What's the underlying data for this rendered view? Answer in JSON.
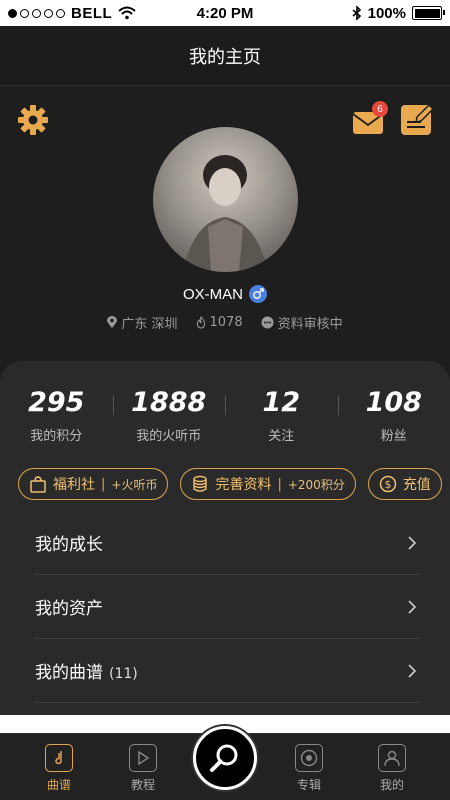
{
  "status_bar": {
    "carrier": "BELL",
    "time": "4:20 PM",
    "battery": "100%"
  },
  "nav": {
    "title": "我的主页"
  },
  "header": {
    "mail_badge": "6",
    "username": "OX-MAN",
    "location": "广东 深圳",
    "heat": "1078",
    "status": "资料审核中"
  },
  "stats": [
    {
      "value": "295",
      "label": "我的积分"
    },
    {
      "value": "1888",
      "label": "我的火听币"
    },
    {
      "value": "12",
      "label": "关注"
    },
    {
      "value": "108",
      "label": "粉丝"
    }
  ],
  "pills": [
    {
      "label": "福利社",
      "sub": "+火听币",
      "icon": "bag-icon"
    },
    {
      "label": "完善资料",
      "sub": "+200积分",
      "icon": "coins-stack-icon"
    },
    {
      "label": "充值",
      "sub": "",
      "icon": "dollar-icon"
    }
  ],
  "menu": [
    {
      "label": "我的成长",
      "count": ""
    },
    {
      "label": "我的资产",
      "count": ""
    },
    {
      "label": "我的曲谱",
      "count": "(11)"
    }
  ],
  "tabs": [
    {
      "label": "曲谱",
      "icon": "music-note-icon",
      "active": true
    },
    {
      "label": "教程",
      "icon": "play-icon",
      "active": false
    },
    {
      "label": "专辑",
      "icon": "album-icon",
      "active": false
    },
    {
      "label": "我的",
      "icon": "user-icon",
      "active": false
    }
  ],
  "colors": {
    "accent": "#e0a64e",
    "background": "#1e1e1e",
    "card": "#2a2a2a",
    "badge": "#e8473c",
    "gender": "#4a7fe0"
  }
}
